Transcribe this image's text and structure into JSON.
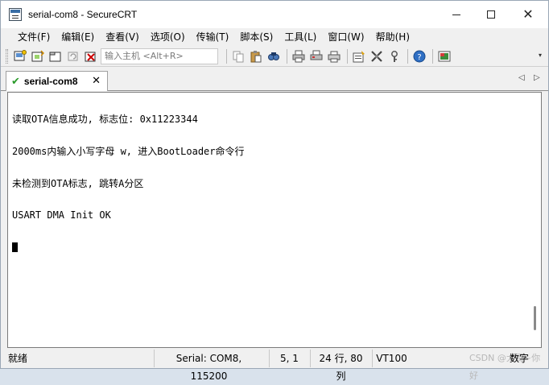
{
  "window": {
    "title": "serial-com8 - SecureCRT",
    "controls": {
      "minimize": "",
      "maximize": "",
      "close": "✕"
    }
  },
  "menu": [
    "文件(F)",
    "编辑(E)",
    "查看(V)",
    "选项(O)",
    "传输(T)",
    "脚本(S)",
    "工具(L)",
    "窗口(W)",
    "帮助(H)"
  ],
  "toolbar": {
    "quick_input_placeholder": "输入主机 <Alt+R>",
    "icons": [
      "connect-icon",
      "quick-connect-icon",
      "connect-tab-icon",
      "reconnect-icon",
      "disconnect-icon",
      "copy-icon",
      "paste-icon",
      "find-icon",
      "print-icon",
      "print-setup-icon",
      "print-screen-icon",
      "session-options-icon",
      "global-options-icon",
      "keymap-icon",
      "help-icon",
      "screenshot-icon"
    ],
    "overflow": "▾"
  },
  "tabs": [
    {
      "label": "serial-com8",
      "status_icon": "✔",
      "close": "✕"
    }
  ],
  "tab_nav": {
    "left": "◁",
    "right": "▷"
  },
  "terminal": {
    "lines": [
      "读取OTA信息成功, 标志位: 0x11223344",
      "2000ms内输入小写字母 w, 进入BootLoader命令行",
      "未检测到OTA标志, 跳转A分区",
      "USART DMA Init OK"
    ]
  },
  "status": {
    "ready": "就绪",
    "serial": "Serial: COM8, 115200",
    "position": "5,  1",
    "size": "24 行, 80 列",
    "emulation": "VT100",
    "watermark": "CSDN @大哥~你好",
    "num": "数字"
  }
}
